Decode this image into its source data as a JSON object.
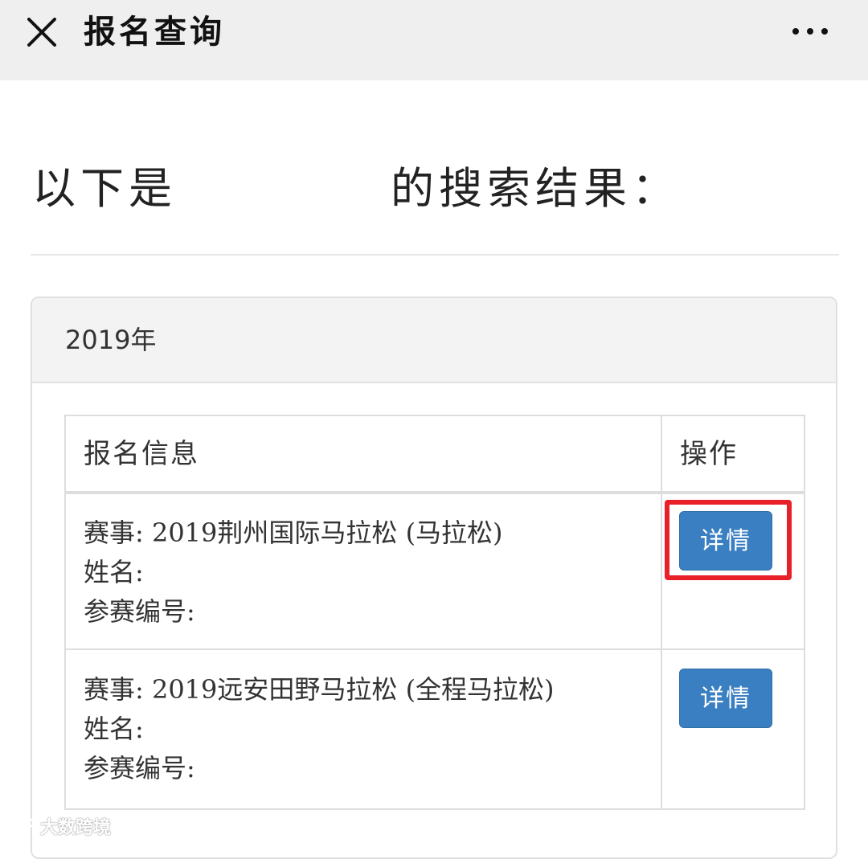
{
  "titlebar": {
    "title": "报名查询",
    "close_icon": "close-icon",
    "more_icon": "more-icon"
  },
  "heading": {
    "prefix": "以下是",
    "suffix": "的搜索结果："
  },
  "panel": {
    "year": "2019年"
  },
  "table": {
    "headers": {
      "info": "报名信息",
      "action": "操作"
    },
    "rows": [
      {
        "event": "赛事: 2019荆州国际马拉松 (马拉松)",
        "name": "姓名:",
        "bib": "参赛编号:",
        "button": "详情"
      },
      {
        "event": "赛事: 2019远安田野马拉松 (全程马拉松)",
        "name": "姓名:",
        "bib": "参赛编号:",
        "button": "详情"
      }
    ]
  },
  "watermark": {
    "text": "大数跨境"
  },
  "colors": {
    "button": "#3a7fc1",
    "highlight": "#e8202a",
    "titlebar": "#efefef"
  }
}
